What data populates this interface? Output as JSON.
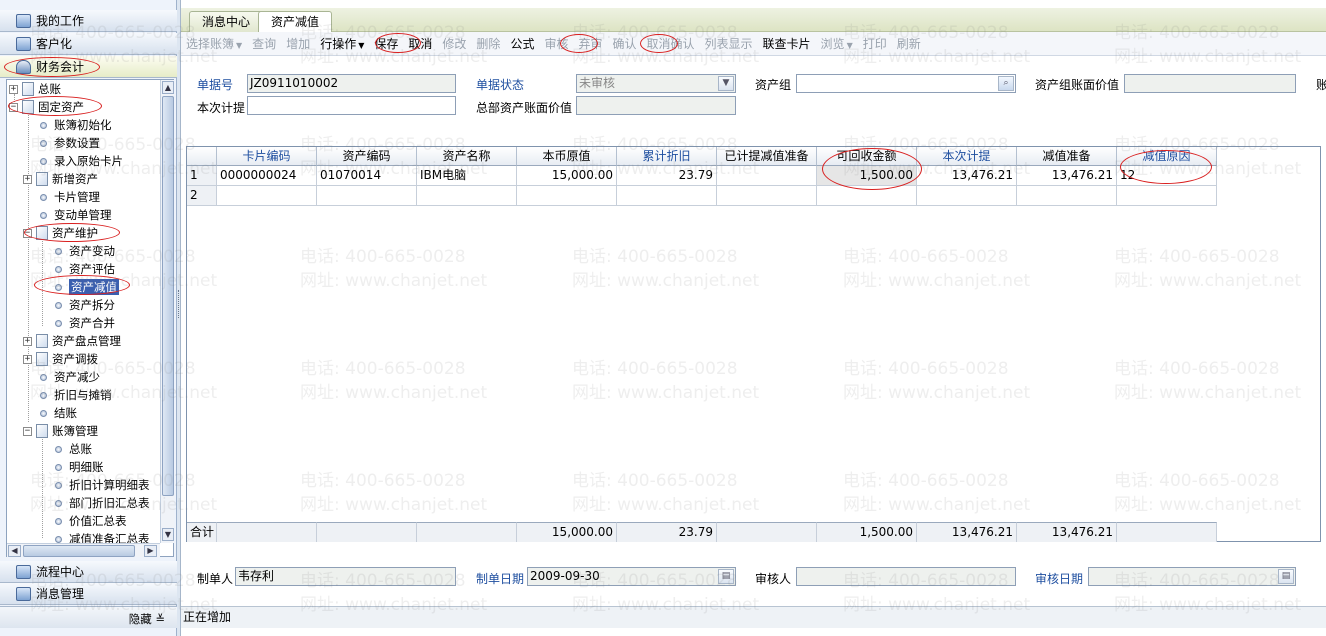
{
  "left_panel": {
    "modules": {
      "my_work": "我的工作",
      "customize": "客户化",
      "finance": "财务会计",
      "workflow": "流程中心",
      "messages": "消息管理"
    },
    "tree": [
      {
        "label": "总账"
      },
      {
        "label": "固定资产"
      },
      {
        "label": "账簿初始化"
      },
      {
        "label": "参数设置"
      },
      {
        "label": "录入原始卡片"
      },
      {
        "label": "新增资产"
      },
      {
        "label": "卡片管理"
      },
      {
        "label": "变动单管理"
      },
      {
        "label": "资产维护"
      },
      {
        "label": "资产变动"
      },
      {
        "label": "资产评估"
      },
      {
        "label": "资产减值"
      },
      {
        "label": "资产拆分"
      },
      {
        "label": "资产合并"
      },
      {
        "label": "资产盘点管理"
      },
      {
        "label": "资产调拨"
      },
      {
        "label": "资产减少"
      },
      {
        "label": "折旧与摊销"
      },
      {
        "label": "结账"
      },
      {
        "label": "账簿管理"
      },
      {
        "label": "总账"
      },
      {
        "label": "明细账"
      },
      {
        "label": "折旧计算明细表"
      },
      {
        "label": "部门折旧汇总表"
      },
      {
        "label": "价值汇总表"
      },
      {
        "label": "减值准备汇总表"
      }
    ],
    "hide_label": "隐藏 ≚"
  },
  "tabs": [
    "消息中心",
    "资产减值"
  ],
  "toolbar": [
    {
      "label": "选择账簿",
      "enabled": false,
      "dropdown": true
    },
    {
      "label": "查询",
      "enabled": false
    },
    {
      "label": "增加",
      "enabled": false
    },
    {
      "label": "行操作",
      "enabled": true,
      "dropdown": true
    },
    {
      "label": "保存",
      "enabled": true
    },
    {
      "label": "取消",
      "enabled": true
    },
    {
      "label": "修改",
      "enabled": false
    },
    {
      "label": "删除",
      "enabled": false
    },
    {
      "label": "公式",
      "enabled": true
    },
    {
      "label": "审核",
      "enabled": false
    },
    {
      "label": "弃审",
      "enabled": false
    },
    {
      "label": "确认",
      "enabled": false
    },
    {
      "label": "取消确认",
      "enabled": false
    },
    {
      "label": "列表显示",
      "enabled": false
    },
    {
      "label": "联查卡片",
      "enabled": true
    },
    {
      "label": "浏览",
      "enabled": false,
      "dropdown": true
    },
    {
      "label": "打印",
      "enabled": false
    },
    {
      "label": "刷新",
      "enabled": false
    }
  ],
  "header_form": {
    "doc_no_label": "单据号",
    "doc_no_value": "JZ0911010002",
    "doc_status_label": "单据状态",
    "doc_status_value": "未审核",
    "asset_group_label": "资产组",
    "asset_group_value": "",
    "asset_group_book_value_label": "资产组账面价值",
    "asset_group_book_value_value": "",
    "truncated_label": "账",
    "this_provision_label": "本次计提",
    "this_provision_value": "",
    "total_book_value_label": "总部资产账面价值",
    "total_book_value_value": ""
  },
  "grid": {
    "columns": [
      "卡片编码",
      "资产编码",
      "资产名称",
      "本币原值",
      "累计折旧",
      "已计提减值准备",
      "可回收金额",
      "本次计提",
      "减值准备",
      "减值原因"
    ],
    "rows": [
      {
        "idx": "1",
        "cells": [
          "0000000024",
          "01070014",
          "IBM电脑",
          "15,000.00",
          "23.79",
          "",
          "1,500.00",
          "13,476.21",
          "13,476.21",
          "12"
        ]
      },
      {
        "idx": "2",
        "cells": [
          "",
          "",
          "",
          "",
          "",
          "",
          "",
          "",
          "",
          ""
        ]
      }
    ],
    "summary_label": "合计",
    "summary": [
      "",
      "",
      "",
      "15,000.00",
      "23.79",
      "",
      "1,500.00",
      "13,476.21",
      "13,476.21",
      ""
    ]
  },
  "footer_form": {
    "maker_label": "制单人",
    "maker_value": "韦存利",
    "make_date_label": "制单日期",
    "make_date_value": "2009-09-30",
    "reviewer_label": "审核人",
    "reviewer_value": "",
    "review_date_label": "审核日期",
    "review_date_value": ""
  },
  "status_text": "正在增加",
  "watermark": {
    "phone": "电话: 400-665-0028",
    "site": "网址: www.chanjet.net"
  }
}
